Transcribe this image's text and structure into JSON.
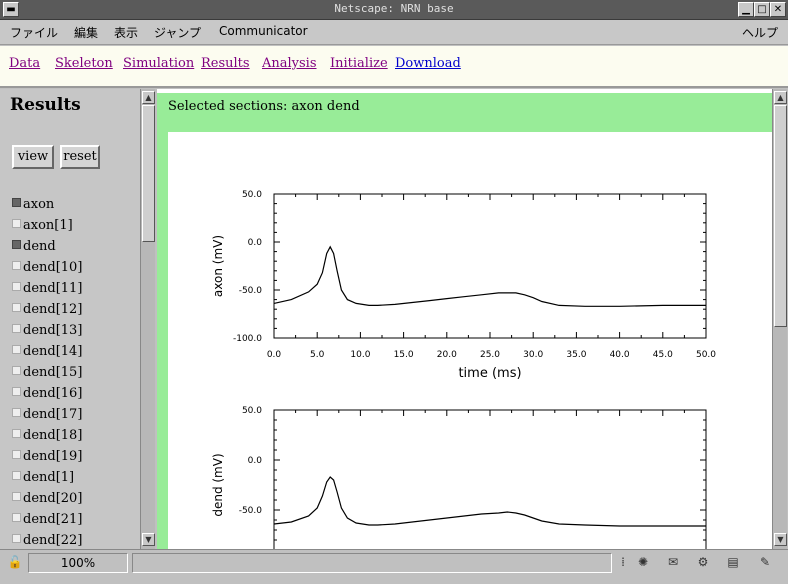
{
  "window": {
    "title": "Netscape: NRN base"
  },
  "menu": [
    "ファイル",
    "編集",
    "表示",
    "ジャンプ",
    "Communicator",
    "ヘルプ"
  ],
  "nav_links": [
    "Data",
    "Skeleton",
    "Simulation",
    "Results",
    "Analysis",
    "Initialize",
    "Download"
  ],
  "sidebar": {
    "heading": "Results",
    "view_label": "view",
    "reset_label": "reset",
    "sections": [
      {
        "label": "axon",
        "checked": true
      },
      {
        "label": "axon[1]",
        "checked": false
      },
      {
        "label": "dend",
        "checked": true
      },
      {
        "label": "dend[10]",
        "checked": false
      },
      {
        "label": "dend[11]",
        "checked": false
      },
      {
        "label": "dend[12]",
        "checked": false
      },
      {
        "label": "dend[13]",
        "checked": false
      },
      {
        "label": "dend[14]",
        "checked": false
      },
      {
        "label": "dend[15]",
        "checked": false
      },
      {
        "label": "dend[16]",
        "checked": false
      },
      {
        "label": "dend[17]",
        "checked": false
      },
      {
        "label": "dend[18]",
        "checked": false
      },
      {
        "label": "dend[19]",
        "checked": false
      },
      {
        "label": "dend[1]",
        "checked": false
      },
      {
        "label": "dend[20]",
        "checked": false
      },
      {
        "label": "dend[21]",
        "checked": false
      },
      {
        "label": "dend[22]",
        "checked": false
      }
    ]
  },
  "main": {
    "selected_text": "Selected sections: axon dend"
  },
  "status": {
    "zoom": "100%"
  },
  "colors": {
    "green": "#98ec98",
    "link_visited": "#800080",
    "link": "#0000cc"
  },
  "chart_data": [
    {
      "type": "line",
      "xlabel": "time (ms)",
      "ylabel": "axon (mV)",
      "xlim": [
        0,
        50
      ],
      "ylim": [
        -100,
        50
      ],
      "x_ticks": [
        "0.0",
        "5.0",
        "10.0",
        "15.0",
        "20.0",
        "25.0",
        "30.0",
        "35.0",
        "40.0",
        "45.0",
        "50.0"
      ],
      "y_ticks": [
        "50.0",
        "0.0",
        "-50.0",
        "-100.0"
      ],
      "series": [
        {
          "x": [
            0,
            2,
            4,
            5,
            5.6,
            6.1,
            6.5,
            6.9,
            7.3,
            7.8,
            8.5,
            9.5,
            11,
            12,
            14,
            16,
            18,
            20,
            22,
            24,
            26,
            27,
            28,
            29,
            30,
            31,
            33,
            36,
            40,
            45,
            50
          ],
          "y": [
            -64,
            -60,
            -52,
            -44,
            -32,
            -12,
            -5,
            -12,
            -30,
            -50,
            -60,
            -64,
            -66,
            -66,
            -65,
            -63,
            -61,
            -59,
            -57,
            -55,
            -53,
            -53,
            -53,
            -55,
            -58,
            -62,
            -66,
            -67,
            -67,
            -66,
            -66
          ]
        }
      ]
    },
    {
      "type": "line",
      "xlabel": "",
      "ylabel": "dend (mV)",
      "xlim": [
        0,
        50
      ],
      "ylim": [
        -100,
        50
      ],
      "y_ticks": [
        "50.0",
        "0.0",
        "-50.0"
      ],
      "series": [
        {
          "x": [
            0,
            2,
            4,
            5,
            5.6,
            6.1,
            6.5,
            6.9,
            7.3,
            7.8,
            8.5,
            9.5,
            11,
            12,
            14,
            16,
            18,
            20,
            22,
            24,
            26,
            27,
            28,
            29,
            30,
            31,
            33,
            36,
            40,
            45,
            50
          ],
          "y": [
            -64,
            -62,
            -56,
            -48,
            -36,
            -22,
            -17,
            -20,
            -32,
            -48,
            -58,
            -63,
            -65,
            -65,
            -64,
            -62,
            -60,
            -58,
            -56,
            -54,
            -53,
            -52,
            -53,
            -55,
            -58,
            -61,
            -64,
            -65,
            -66,
            -66,
            -66
          ]
        }
      ]
    }
  ]
}
